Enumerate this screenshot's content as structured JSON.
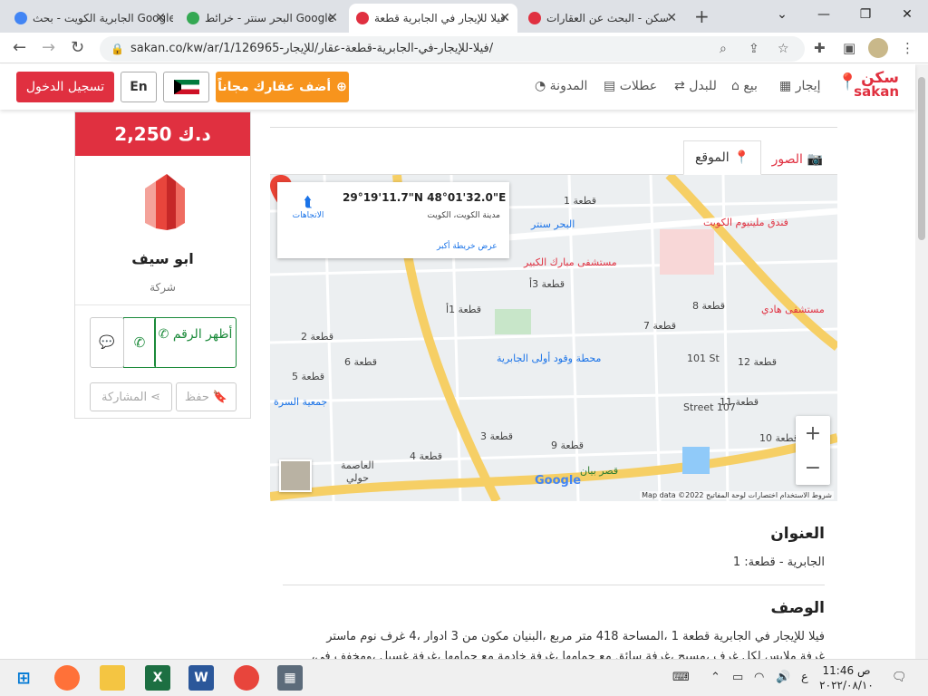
{
  "browser": {
    "tabs": [
      {
        "title": "الجابرية الكويت - بحث Google",
        "active": false
      },
      {
        "title": "البحر سنتر - خرائط Google",
        "active": false
      },
      {
        "title": "فيلا للإيجار في الجابرية قطعة",
        "active": true
      },
      {
        "title": "سكن - البحث عن العقارات",
        "active": false
      }
    ],
    "new_tab_label": "+",
    "url": "sakan.co/kw/ar/1/126965-فيلا-للإيجار-في-الجابرية-قطعة-عقار/للإيجار/"
  },
  "header": {
    "logo_ar": "سكن",
    "logo_en": "sakan",
    "nav": [
      {
        "label": "إيجار",
        "icon": "building-icon"
      },
      {
        "label": "بيع",
        "icon": "home-icon"
      },
      {
        "label": "للبدل",
        "icon": "swap-icon"
      },
      {
        "label": "عطلات",
        "icon": "suitcase-icon"
      },
      {
        "label": "المدونة",
        "icon": "rss-icon"
      }
    ],
    "add_property": "أضف عقارك مجاناً",
    "lang": "En",
    "login": "تسجيل الدخول"
  },
  "agent": {
    "price": "2,250 د.ك",
    "name": "ابو سيف",
    "type": "شركة",
    "show_number": "أظهر الرقم",
    "save": "حفظ",
    "share": "المشاركة"
  },
  "listing_tabs": {
    "photos": "الصور",
    "location": "الموقع"
  },
  "map": {
    "coords": "29°19'11.7\"N 48°01'32.0\"E",
    "city": "مدينة الكويت، الكويت",
    "directions": "الاتجاهات",
    "bigger_map": "عرض خريطة أكبر",
    "attribution": "Map data ©2022   شروط الاستخدام   اختصارات لوحة المفاتيح",
    "google": "Google",
    "labels": [
      {
        "text": "قطعة 1",
        "cls": ""
      },
      {
        "text": "البحر سنتر",
        "cls": "blue"
      },
      {
        "text": "فندق ملينيوم الكويت",
        "cls": "poi"
      },
      {
        "text": "مستشفى مبارك الكبير",
        "cls": "poi"
      },
      {
        "text": "قطعة 3أ",
        "cls": ""
      },
      {
        "text": "قطعة 8",
        "cls": ""
      },
      {
        "text": "مستشفى هادي",
        "cls": "poi"
      },
      {
        "text": "قطعة 7",
        "cls": ""
      },
      {
        "text": "قطعة 1أ",
        "cls": ""
      },
      {
        "text": "قطعة 2",
        "cls": ""
      },
      {
        "text": "محطة وقود أولى الجابرية",
        "cls": "blue"
      },
      {
        "text": "قطعة 6",
        "cls": ""
      },
      {
        "text": "قطعة 5",
        "cls": ""
      },
      {
        "text": "قطعة 12",
        "cls": ""
      },
      {
        "text": "جمعية السرة",
        "cls": "blue"
      },
      {
        "text": "قطعة 11",
        "cls": ""
      },
      {
        "text": "قطعة 4",
        "cls": ""
      },
      {
        "text": "قطعة 9",
        "cls": ""
      },
      {
        "text": "قطعة 3",
        "cls": ""
      },
      {
        "text": "العاصمة",
        "cls": ""
      },
      {
        "text": "حولي",
        "cls": ""
      },
      {
        "text": "قصر بيان",
        "cls": "green"
      },
      {
        "text": "قطعة 10",
        "cls": ""
      },
      {
        "text": "101 St",
        "cls": ""
      },
      {
        "text": "Street 107",
        "cls": ""
      }
    ]
  },
  "address": {
    "title": "العنوان",
    "value": "الجابرية - قطعة: 1"
  },
  "description": {
    "title": "الوصف",
    "line1": "فيلا للإيجار في الجابرية قطعة 1 ،المساحة 418 متر مربع ،البنيان مكون من 3 ادوار ،4 غرف نوم ماستر",
    "line2": "،غرفة ملابس لكل غرف ،مسبح ،غرفة سائق مع حمامها ،غرفة خادمة مع حمامها ،غرفة غسيل ،ومخفف في"
  },
  "taskbar": {
    "time": "11:46 ص",
    "date": "٢٠٢٢/٠٨/١٠",
    "lang": "ع"
  },
  "colors": {
    "brand_red": "#e03040",
    "orange": "#f7941d",
    "green": "#1b8a3a"
  }
}
